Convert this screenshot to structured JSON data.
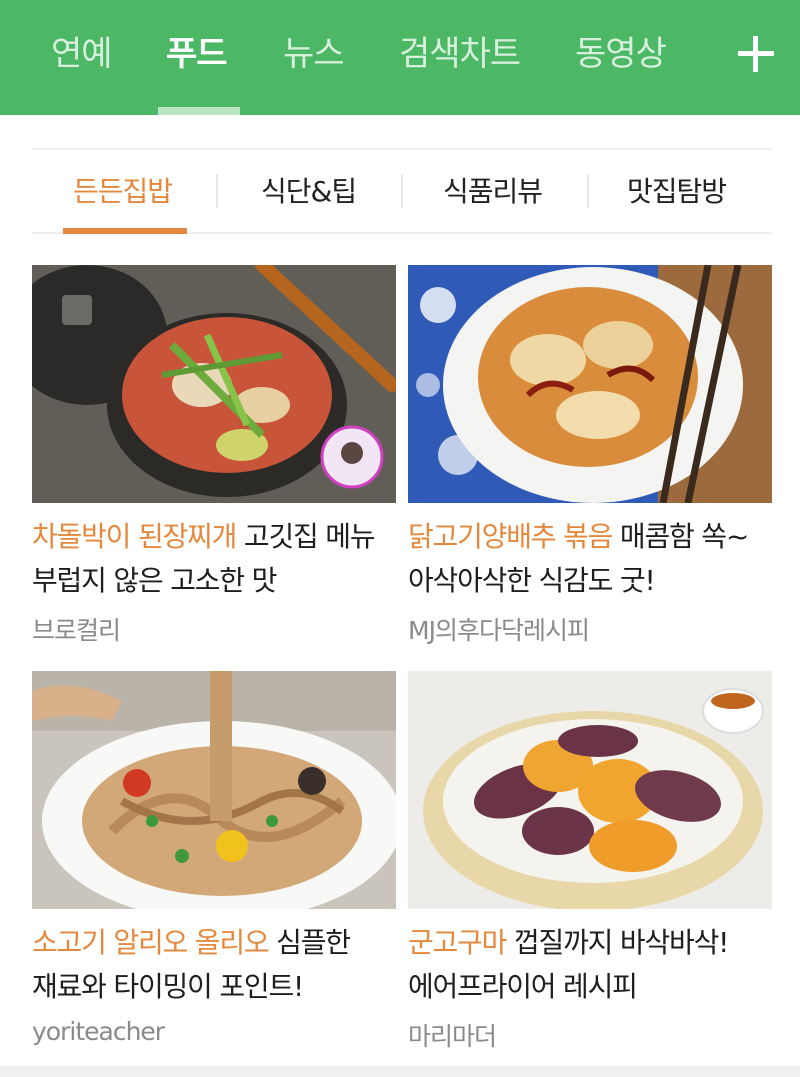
{
  "top_nav": {
    "tabs": [
      {
        "label": "연예"
      },
      {
        "label": "푸드",
        "active": true
      },
      {
        "label": "뉴스"
      },
      {
        "label": "검색차트"
      },
      {
        "label": "동영상"
      }
    ],
    "add_icon": "plus-icon"
  },
  "sub_nav": {
    "tabs": [
      {
        "label": "든든집밥",
        "active": true
      },
      {
        "label": "식단&팁"
      },
      {
        "label": "식품리뷰"
      },
      {
        "label": "맛집탐방"
      }
    ]
  },
  "cards": [
    {
      "title_highlight": "차돌박이 된장찌개",
      "title_rest": " 고깃집 메뉴 부럽지 않은 고소한 맛",
      "source": "브로컬리",
      "image": "doenjang-stew-photo"
    },
    {
      "title_highlight": "닭고기양배추 볶음",
      "title_rest": " 매콤함 쏙~ 아삭아삭한 식감도 굿!",
      "source": "MJ의후다닥레시피",
      "image": "chicken-cabbage-stirfry-photo"
    },
    {
      "title_highlight": "소고기 알리오 올리오",
      "title_rest": " 심플한 재료와 타이밍이 포인트!",
      "source": "yoriteacher",
      "image": "beef-aglio-olio-photo"
    },
    {
      "title_highlight": "군고구마",
      "title_rest": " 껍질까지 바삭바삭! 에어프라이어 레시피",
      "source": "마리마더",
      "image": "roasted-sweet-potato-photo"
    }
  ],
  "colors": {
    "brand_green": "#4cb865",
    "accent_orange": "#e4883d"
  }
}
